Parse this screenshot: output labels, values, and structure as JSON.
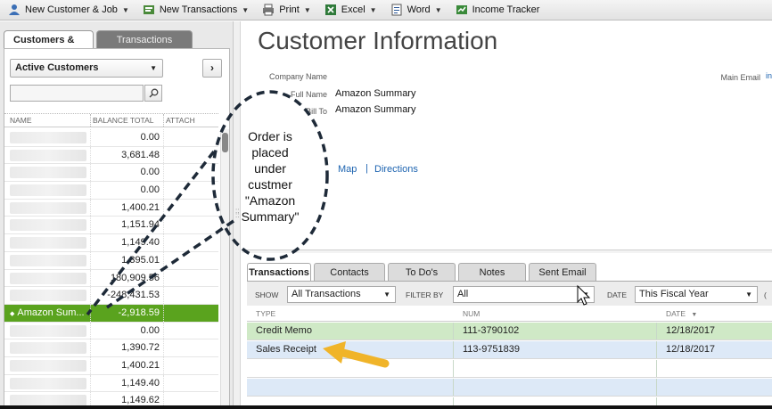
{
  "toolbar": {
    "items": [
      {
        "label": "New Customer & Job",
        "icon": "new-customer-icon"
      },
      {
        "label": "New Transactions",
        "icon": "new-transactions-icon"
      },
      {
        "label": "Print",
        "icon": "print-icon"
      },
      {
        "label": "Excel",
        "icon": "excel-icon"
      },
      {
        "label": "Word",
        "icon": "word-icon"
      },
      {
        "label": "Income Tracker",
        "icon": "income-tracker-icon"
      }
    ]
  },
  "left_panel": {
    "tabs": [
      "Customers & Jobs",
      "Transactions"
    ],
    "view_select": "Active Customers",
    "columns": {
      "name": "NAME",
      "balance": "BALANCE TOTAL",
      "attach": "ATTACH"
    },
    "rows": [
      {
        "name": "",
        "balance": "0.00"
      },
      {
        "name": "",
        "balance": "3,681.48"
      },
      {
        "name": "",
        "balance": "0.00"
      },
      {
        "name": "",
        "balance": "0.00"
      },
      {
        "name": "",
        "balance": "1,400.21"
      },
      {
        "name": "",
        "balance": "1,151.94"
      },
      {
        "name": "",
        "balance": "1,149.40"
      },
      {
        "name": "",
        "balance": "1,395.01"
      },
      {
        "name": "",
        "balance": "180,909.56"
      },
      {
        "name": "",
        "balance": "-248,431.53"
      },
      {
        "name": "Amazon Sum...",
        "balance": "-2,918.59",
        "selected": true
      },
      {
        "name": "",
        "balance": "0.00"
      },
      {
        "name": "",
        "balance": "1,390.72"
      },
      {
        "name": "",
        "balance": "1,400.21"
      },
      {
        "name": "",
        "balance": "1,149.40"
      },
      {
        "name": "",
        "balance": "1,149.62"
      }
    ]
  },
  "customer_info": {
    "title": "Customer Information",
    "company_name_label": "Company Name",
    "full_name_label": "Full Name",
    "full_name": "Amazon Summary",
    "bill_to_label": "Bill To",
    "bill_to": "Amazon Summary",
    "main_email_label": "Main Email",
    "main_email_value": "in",
    "map_link": "Map",
    "directions_link": "Directions"
  },
  "transactions_panel": {
    "tabs": [
      "Transactions",
      "Contacts",
      "To Do's",
      "Notes",
      "Sent Email"
    ],
    "show_label": "SHOW",
    "show_value": "All Transactions",
    "filter_label": "FILTER BY",
    "filter_value": "All",
    "date_label": "DATE",
    "date_value": "This Fiscal Year",
    "columns": {
      "type": "TYPE",
      "num": "NUM",
      "date": "DATE"
    },
    "rows": [
      {
        "type": "Credit Memo",
        "num": "111-3790102",
        "date": "12/18/2017"
      },
      {
        "type": "Sales Receipt",
        "num": "113-9751839",
        "date": "12/18/2017"
      }
    ]
  },
  "annotation": {
    "text_lines": [
      "Order is",
      "placed",
      "under",
      "custmer",
      "\"Amazon",
      "Summary\""
    ]
  },
  "colors": {
    "selected_row": "#5aa31e",
    "credit_memo_row": "#cfe9c6",
    "sales_receipt_row": "#dde9f7",
    "link": "#1c63b0",
    "arrow": "#f0b429"
  }
}
